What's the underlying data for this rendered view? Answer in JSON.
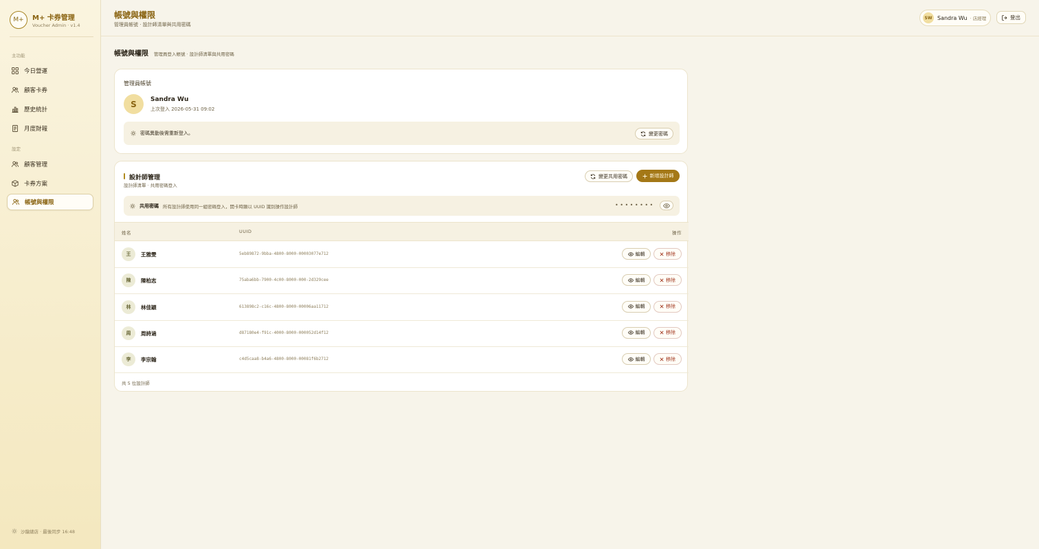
{
  "brand": {
    "logo": "M+",
    "title": "M+ 卡券管理",
    "subtitle": "Voucher Admin · v1.4"
  },
  "sidebar": {
    "section_main": "主功能",
    "section_settings": "設定",
    "items": [
      {
        "label": "今日營運",
        "icon": "grid-icon"
      },
      {
        "label": "顧客卡券",
        "icon": "users-icon"
      },
      {
        "label": "歷史統計",
        "icon": "bar-chart-icon"
      },
      {
        "label": "月度財報",
        "icon": "document-icon"
      },
      {
        "label": "顧客管理",
        "icon": "users-icon"
      },
      {
        "label": "卡券方案",
        "icon": "box-icon"
      },
      {
        "label": "帳號與權限",
        "icon": "users-icon",
        "active": true
      }
    ],
    "footer": "沙龍總店 · 最後同步 16:48"
  },
  "header": {
    "title": "帳號與權限",
    "subtitle": "管理員帳號 · 設計師清單與共用密碼",
    "user_initials": "SW",
    "user_name": "Sandra Wu",
    "user_role": "· 店經理",
    "logout_label": "登出"
  },
  "section": {
    "title": "帳號與權限",
    "subtitle": "管理員登入帳號 · 設計師清單與共用密碼"
  },
  "admin_card": {
    "label": "管理員帳號",
    "avatar": "S",
    "name": "Sandra Wu",
    "last_login": "上次登入 2026-05-31 09:02",
    "notice": "密碼異動後需重新登入。",
    "change_password_label": "變更密碼"
  },
  "designers_card": {
    "title": "設計師管理",
    "subtitle": "設計師清單 · 共用密碼登入",
    "change_shared_label": "變更共用密碼",
    "add_label": "新增設計師",
    "shared_label": "共用密碼",
    "shared_desc": "所有設計師使用同一組密碼登入，開卡時顯以 UUID 識別操作設計師",
    "shared_mask": "••••••••",
    "columns": {
      "name": "姓名",
      "uuid": "UUID",
      "actions": "操作"
    },
    "edit_label": "編輯",
    "remove_label": "移除",
    "rows": [
      {
        "initial": "王",
        "name": "王雅雯",
        "uuid": "5eb89872-9bba-4800-8000-00003077e712"
      },
      {
        "initial": "陳",
        "name": "陳柏志",
        "uuid": "75aba6bb-7900-4c00-8000-000-2d329cee"
      },
      {
        "initial": "林",
        "name": "林佳穎",
        "uuid": "613898c2-c16c-4800-8000-00006aa11712"
      },
      {
        "initial": "周",
        "name": "周詩涵",
        "uuid": "d87180e4-f91c-4000-8000-000052d14f12"
      },
      {
        "initial": "李",
        "name": "李宗翰",
        "uuid": "c4d5caa8-b4a6-4800-8000-00081f6b2712"
      }
    ],
    "footer": "共 5 位設計師"
  },
  "colors": {
    "accent": "#a47817",
    "danger": "#a33a22",
    "background": "#f7f4ea"
  }
}
